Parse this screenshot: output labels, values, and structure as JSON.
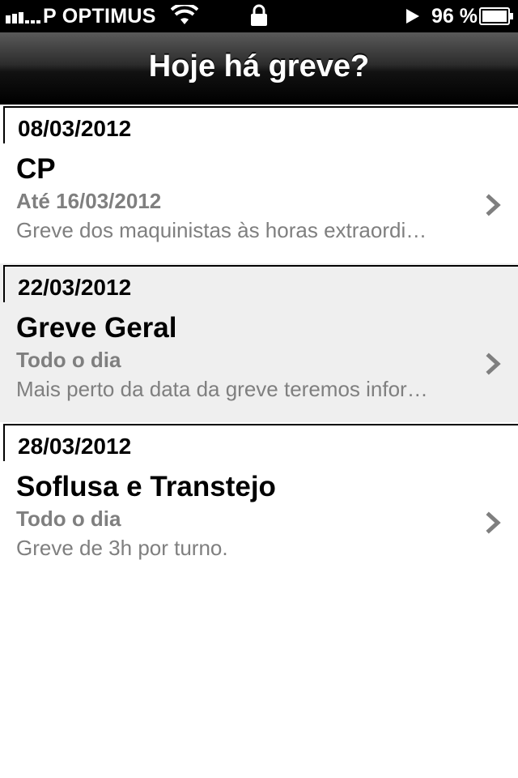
{
  "status_bar": {
    "carrier": "P OPTIMUS",
    "battery_percent": "96 %",
    "icons": [
      "signal-bars-icon",
      "wifi-icon",
      "lock-icon",
      "play-icon",
      "battery-icon"
    ]
  },
  "nav": {
    "title": "Hoje há greve?"
  },
  "strikes": [
    {
      "date": "08/03/2012",
      "title": "CP",
      "time": "Até 16/03/2012",
      "description": "Greve dos maquinistas às horas extraordi…"
    },
    {
      "date": "22/03/2012",
      "title": "Greve Geral",
      "time": "Todo o dia",
      "description": "Mais perto da data da greve teremos infor…"
    },
    {
      "date": "28/03/2012",
      "title": "Soflusa e Transtejo",
      "time": "Todo o dia",
      "description": "Greve de 3h por turno."
    }
  ],
  "colors": {
    "nav_gradient_top": "#5a5a5a",
    "nav_gradient_bottom": "#000000",
    "highlight_row": "#efefef",
    "secondary_text": "#7f7f7f"
  }
}
